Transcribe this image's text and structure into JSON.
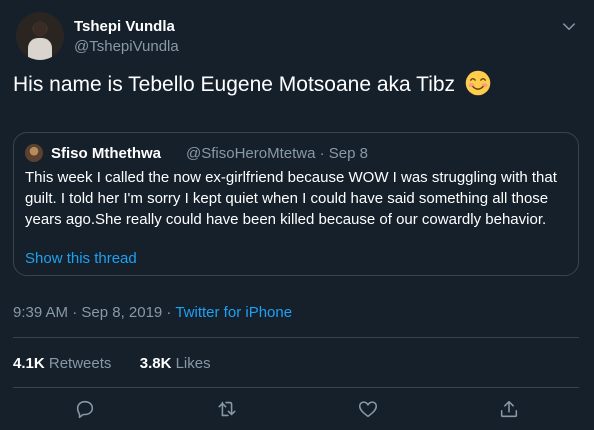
{
  "author": {
    "display_name": "Tshepi Vundla",
    "handle": "@TshepiVundla"
  },
  "tweet": {
    "text": "His name is Tebello Eugene Motsoane aka Tibz",
    "emoji_name": "smiling-face-with-smiling-eyes"
  },
  "quoted_tweet": {
    "display_name": "Sfiso Mthethwa",
    "handle_date": "@SfisoHeroMtetwa · Sep 8",
    "text": "This week I called the now ex-girlfriend because WOW I was struggling with that guilt. I told her I'm sorry I kept quiet when I could have said something all those years ago.She really could have been killed because of our cowardly behavior.",
    "show_thread_label": "Show this thread"
  },
  "meta": {
    "timestamp": "9:39 AM · Sep 8, 2019 ·",
    "source": "Twitter for iPhone"
  },
  "stats": {
    "retweets_count": "4.1K",
    "retweets_label": "Retweets",
    "likes_count": "3.8K",
    "likes_label": "Likes"
  },
  "actions": [
    "reply-icon",
    "retweet-icon",
    "like-icon",
    "share-icon"
  ],
  "colors": {
    "background": "#15202b",
    "accent": "#1da1f2",
    "secondary_text": "#8899a6",
    "border": "#38444d"
  }
}
